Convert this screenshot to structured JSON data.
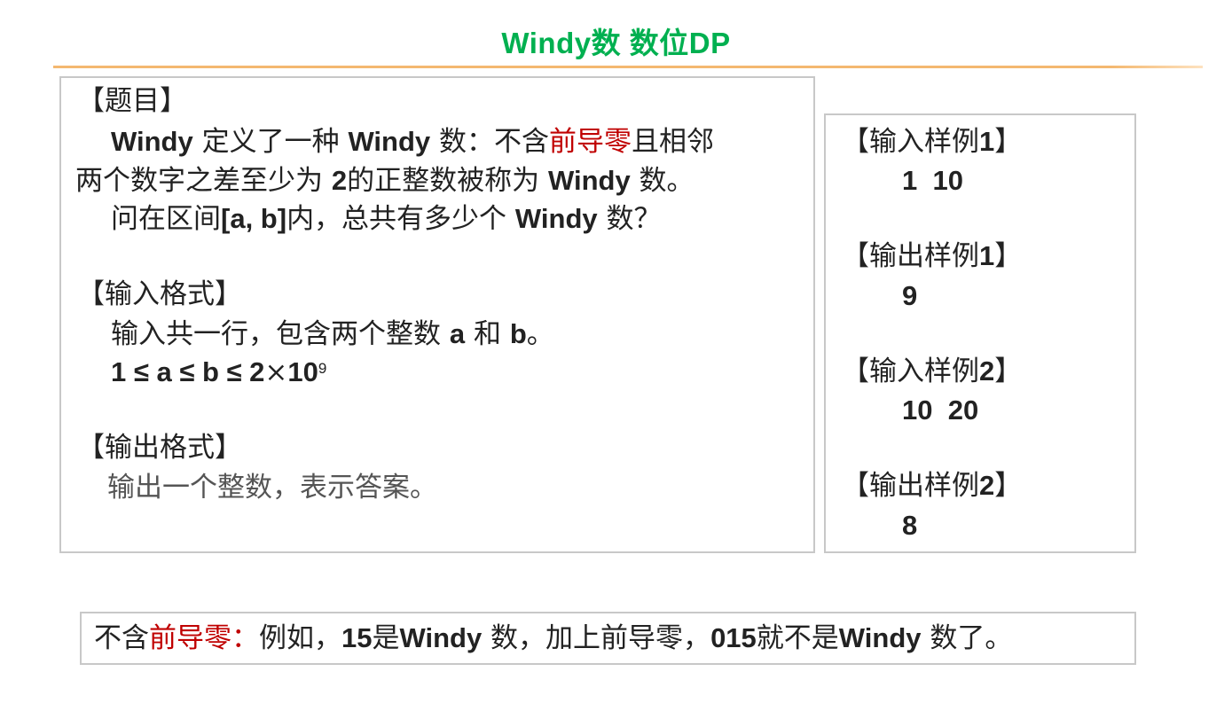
{
  "header": {
    "title": "Windy数  数位DP"
  },
  "problem": {
    "section_title": "【题目】",
    "p1_seg1": "Windy",
    "p1_seg2": " 定义了一种 ",
    "p1_seg3": "Windy",
    "p1_seg4": " 数：不含",
    "p1_highlight": "前导零",
    "p1_seg5": "且相邻",
    "p2_seg1": "两个数字之差至少为 ",
    "p2_num": "2",
    "p2_seg2": "的正整数被称为 ",
    "p2_seg3": "Windy",
    "p2_seg4": " 数。",
    "p3_seg1": "问在区间",
    "p3_range": "[a, b]",
    "p3_seg2": "内，总共有多少个 ",
    "p3_seg3": "Windy",
    "p3_seg4": " 数？"
  },
  "input_format": {
    "section_title": "【输入格式】",
    "desc_seg1": "输入共一行，包含两个整数 ",
    "desc_a": "a",
    "desc_seg2": " 和 ",
    "desc_b": "b",
    "desc_seg3": "。",
    "constraint": "1 ≤ a ≤ b ≤ 2",
    "times": "×",
    "base": "10",
    "exponent": "9"
  },
  "output_format": {
    "section_title": "【输出格式】",
    "desc": "输出一个整数，表示答案。"
  },
  "samples": [
    {
      "open": "【",
      "label": "输入样例",
      "num": "1",
      "close": "】",
      "value": "1  10"
    },
    {
      "open": "【",
      "label": "输出样例",
      "num": "1",
      "close": "】",
      "value": "9"
    },
    {
      "open": "【",
      "label": "输入样例",
      "num": "2",
      "close": "】",
      "value": "10  20"
    },
    {
      "open": "【",
      "label": "输出样例",
      "num": "2",
      "close": "】",
      "value": "8"
    }
  ],
  "note": {
    "seg1": "不含",
    "highlight": "前导零：",
    "seg2": "例如，",
    "num1": "15",
    "seg3": "是",
    "w1": "Windy",
    "seg4": " 数，加上前导零，",
    "num2": "015",
    "seg5": "就不是",
    "w2": "Windy",
    "seg6": " 数了。"
  },
  "colors": {
    "title": "#00b050",
    "highlight": "#c00000",
    "rule": "#f4b870",
    "border": "#c8c8c8"
  }
}
